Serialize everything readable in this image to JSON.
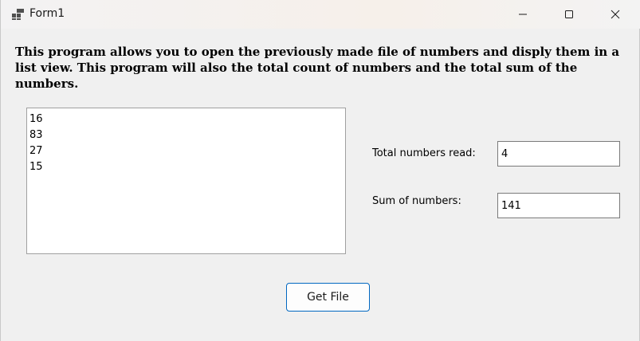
{
  "window": {
    "title": "Form1",
    "app_icon": "form-app-icon",
    "controls": [
      "minimize-icon",
      "maximize-icon",
      "close-icon"
    ]
  },
  "description": "This program allows you to open the previously made file of numbers and disply them in a list view. This program will also the total count of numbers and the total sum of the numbers.",
  "list": {
    "items": [
      "16",
      "83",
      "27",
      "15"
    ]
  },
  "stats": {
    "count_label": "Total numbers read:",
    "count_value": "4",
    "sum_label": "Sum of numbers:",
    "sum_value": "141"
  },
  "buttons": {
    "get_file": "Get File"
  },
  "colors": {
    "accent": "#0067c0",
    "background": "#f0f0f0"
  }
}
